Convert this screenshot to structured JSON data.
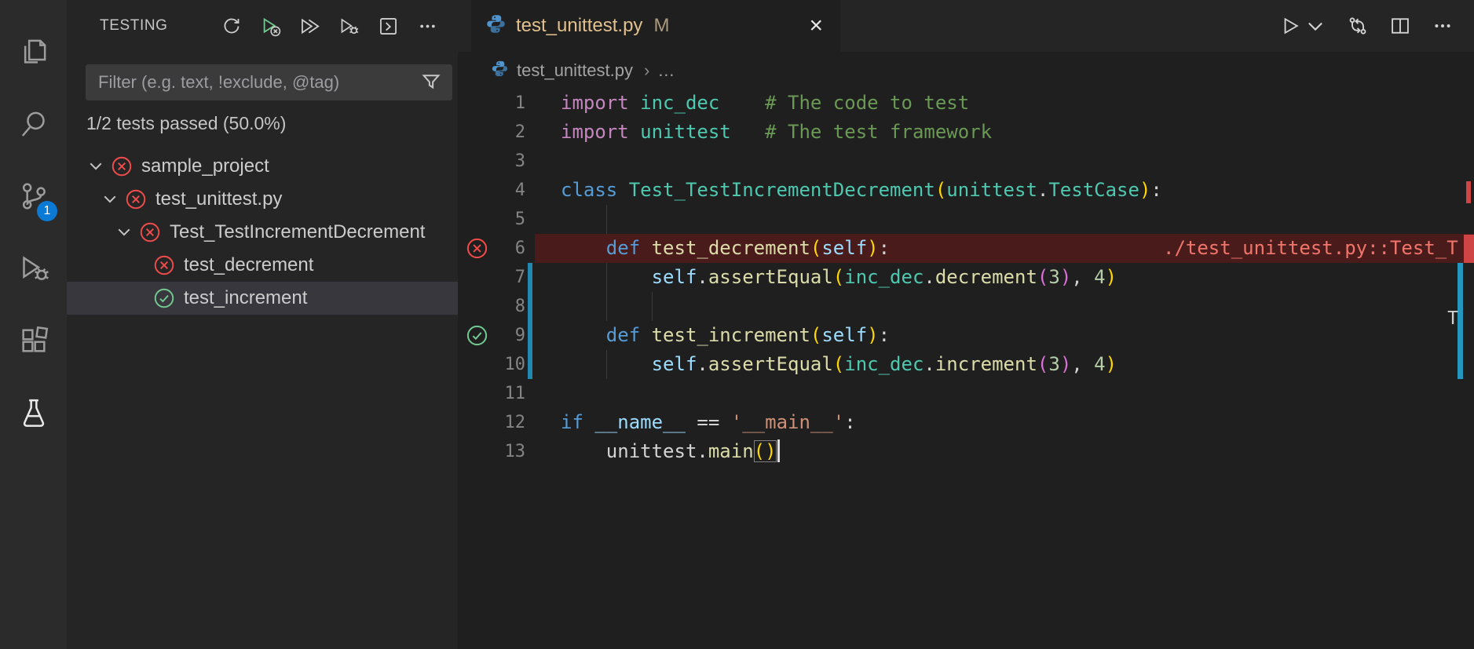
{
  "activity_bar": {
    "items": [
      {
        "id": "explorer",
        "label": "Explorer"
      },
      {
        "id": "search",
        "label": "Search"
      },
      {
        "id": "source-control",
        "label": "Source Control",
        "badge": "1"
      },
      {
        "id": "run-debug",
        "label": "Run and Debug"
      },
      {
        "id": "extensions",
        "label": "Extensions"
      },
      {
        "id": "testing",
        "label": "Testing",
        "active": true
      }
    ]
  },
  "sidebar": {
    "title": "TESTING",
    "toolbar": [
      {
        "id": "refresh",
        "label": "Refresh Tests"
      },
      {
        "id": "run-failed",
        "label": "Rerun Failed Tests"
      },
      {
        "id": "run-all",
        "label": "Run Tests"
      },
      {
        "id": "debug-all",
        "label": "Debug Tests"
      },
      {
        "id": "show-output",
        "label": "Show Output"
      },
      {
        "id": "more",
        "label": "More Actions"
      }
    ],
    "filter": {
      "placeholder": "Filter (e.g. text, !exclude, @tag)"
    },
    "summary": "1/2 tests passed (50.0%)",
    "tree": [
      {
        "label": "sample_project",
        "status": "failed",
        "depth": 0,
        "expandable": true,
        "expanded": true,
        "selected": false
      },
      {
        "label": "test_unittest.py",
        "status": "failed",
        "depth": 1,
        "expandable": true,
        "expanded": true,
        "selected": false
      },
      {
        "label": "Test_TestIncrementDecrement",
        "status": "failed",
        "depth": 2,
        "expandable": true,
        "expanded": true,
        "selected": false
      },
      {
        "label": "test_decrement",
        "status": "failed",
        "depth": 3,
        "expandable": false,
        "expanded": false,
        "selected": false
      },
      {
        "label": "test_increment",
        "status": "passed",
        "depth": 3,
        "expandable": false,
        "expanded": false,
        "selected": true
      }
    ]
  },
  "editor": {
    "tab": {
      "title": "test_unittest.py",
      "modified_badge": "M",
      "close": "×"
    },
    "actions": [
      {
        "id": "run",
        "label": "Run or Debug"
      },
      {
        "id": "open-changes",
        "label": "Open Changes"
      },
      {
        "id": "split",
        "label": "Split Editor"
      },
      {
        "id": "more",
        "label": "More Actions"
      }
    ],
    "breadcrumb": {
      "file": "test_unittest.py",
      "separator": "›",
      "ellipsis": "…"
    },
    "test_error": {
      "line": 6,
      "message": "./test_unittest.py::Test_T"
    },
    "ruler_artifact": "T",
    "code": {
      "lines": [
        {
          "n": 1,
          "tokens": [
            [
              "ctrl",
              "import"
            ],
            [
              "pln",
              " "
            ],
            [
              "mod",
              "inc_dec"
            ],
            [
              "pln",
              "    "
            ],
            [
              "com",
              "# The code to test"
            ]
          ]
        },
        {
          "n": 2,
          "tokens": [
            [
              "ctrl",
              "import"
            ],
            [
              "pln",
              " "
            ],
            [
              "mod",
              "unittest"
            ],
            [
              "pln",
              "   "
            ],
            [
              "com",
              "# The test framework"
            ]
          ]
        },
        {
          "n": 3,
          "tokens": []
        },
        {
          "n": 4,
          "tokens": [
            [
              "kw",
              "class"
            ],
            [
              "pln",
              " "
            ],
            [
              "cls",
              "Test_TestIncrementDecrement"
            ],
            [
              "b1",
              "("
            ],
            [
              "mod",
              "unittest"
            ],
            [
              "pln",
              "."
            ],
            [
              "cls",
              "TestCase"
            ],
            [
              "b1",
              ")"
            ],
            [
              "pln",
              ":"
            ]
          ]
        },
        {
          "n": 5,
          "tokens": [],
          "guides": [
            4
          ]
        },
        {
          "n": 6,
          "status": "failed",
          "error": true,
          "tokens": [
            [
              "pln",
              "    "
            ],
            [
              "kw",
              "def"
            ],
            [
              "pln",
              " "
            ],
            [
              "fn",
              "test_decrement"
            ],
            [
              "b1",
              "("
            ],
            [
              "self",
              "self"
            ],
            [
              "b1",
              ")"
            ],
            [
              "pln",
              ":"
            ]
          ]
        },
        {
          "n": 7,
          "changed": true,
          "guides": [
            4
          ],
          "tokens": [
            [
              "pln",
              "        "
            ],
            [
              "self",
              "self"
            ],
            [
              "pln",
              "."
            ],
            [
              "fn",
              "assertEqual"
            ],
            [
              "b1",
              "("
            ],
            [
              "mod",
              "inc_dec"
            ],
            [
              "pln",
              "."
            ],
            [
              "fn",
              "decrement"
            ],
            [
              "b2",
              "("
            ],
            [
              "num",
              "3"
            ],
            [
              "b2",
              ")"
            ],
            [
              "pln",
              ", "
            ],
            [
              "num",
              "4"
            ],
            [
              "b1",
              ")"
            ]
          ]
        },
        {
          "n": 8,
          "changed": true,
          "guides": [
            4,
            8
          ],
          "tokens": []
        },
        {
          "n": 9,
          "status": "passed",
          "changed": true,
          "tokens": [
            [
              "pln",
              "    "
            ],
            [
              "kw",
              "def"
            ],
            [
              "pln",
              " "
            ],
            [
              "fn",
              "test_increment"
            ],
            [
              "b1",
              "("
            ],
            [
              "self",
              "self"
            ],
            [
              "b1",
              ")"
            ],
            [
              "pln",
              ":"
            ]
          ]
        },
        {
          "n": 10,
          "changed": true,
          "guides": [
            4
          ],
          "tokens": [
            [
              "pln",
              "        "
            ],
            [
              "self",
              "self"
            ],
            [
              "pln",
              "."
            ],
            [
              "fn",
              "assertEqual"
            ],
            [
              "b1",
              "("
            ],
            [
              "mod",
              "inc_dec"
            ],
            [
              "pln",
              "."
            ],
            [
              "fn",
              "increment"
            ],
            [
              "b2",
              "("
            ],
            [
              "num",
              "3"
            ],
            [
              "b2",
              ")"
            ],
            [
              "pln",
              ", "
            ],
            [
              "num",
              "4"
            ],
            [
              "b1",
              ")"
            ]
          ]
        },
        {
          "n": 11,
          "tokens": []
        },
        {
          "n": 12,
          "tokens": [
            [
              "kw",
              "if"
            ],
            [
              "pln",
              " "
            ],
            [
              "var",
              "__name__"
            ],
            [
              "pln",
              " "
            ],
            [
              "op",
              "=="
            ],
            [
              "pln",
              " "
            ],
            [
              "str",
              "'__main__'"
            ],
            [
              "pln",
              ":"
            ]
          ]
        },
        {
          "n": 13,
          "cursor": true,
          "tokens": [
            [
              "pln",
              "    "
            ],
            [
              "pln",
              "unittest"
            ],
            [
              "pln",
              "."
            ],
            [
              "fn",
              "main"
            ],
            [
              "b1",
              "()",
              "box"
            ]
          ]
        }
      ]
    }
  }
}
